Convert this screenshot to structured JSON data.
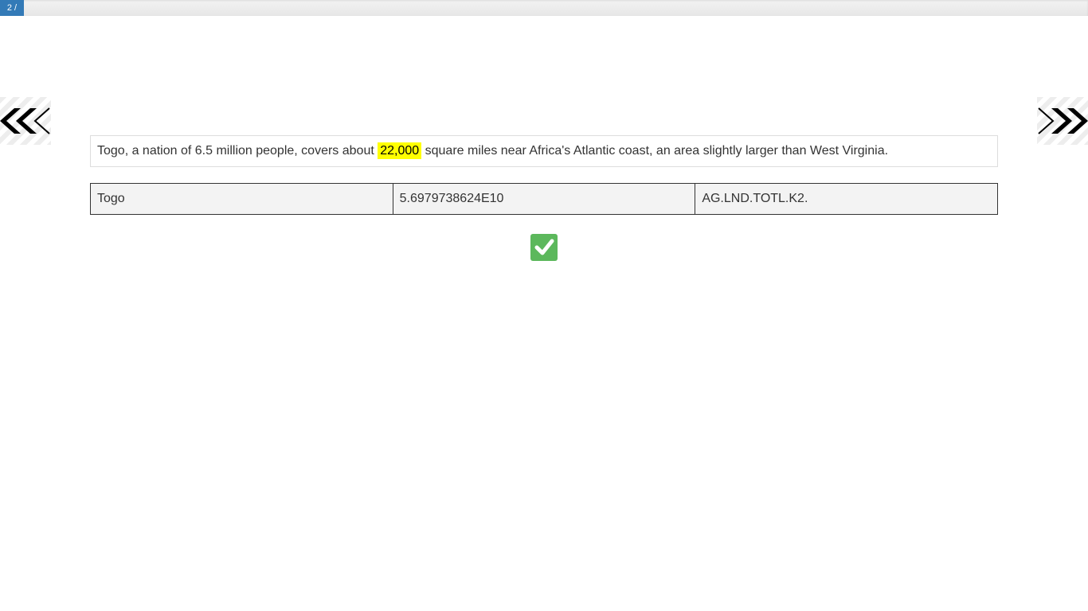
{
  "progress": {
    "label": "2 /",
    "fraction": 0.022
  },
  "navigation": {
    "prev_icon": "double-chevron-left-icon",
    "next_icon": "double-chevron-right-icon"
  },
  "sentence": {
    "before": "Togo, a nation of 6.5 million people, covers about ",
    "highlight": "22,000",
    "after": " square miles near Africa's Atlantic coast, an area slightly larger than West Virginia.",
    "highlight_color": "#ffff00"
  },
  "table": {
    "rows": [
      [
        "Togo",
        "5.6979738624E10",
        "AG.LND.TOTL.K2."
      ]
    ]
  },
  "confirm": {
    "icon": "checkmark-icon",
    "color": "#5cb85c"
  }
}
